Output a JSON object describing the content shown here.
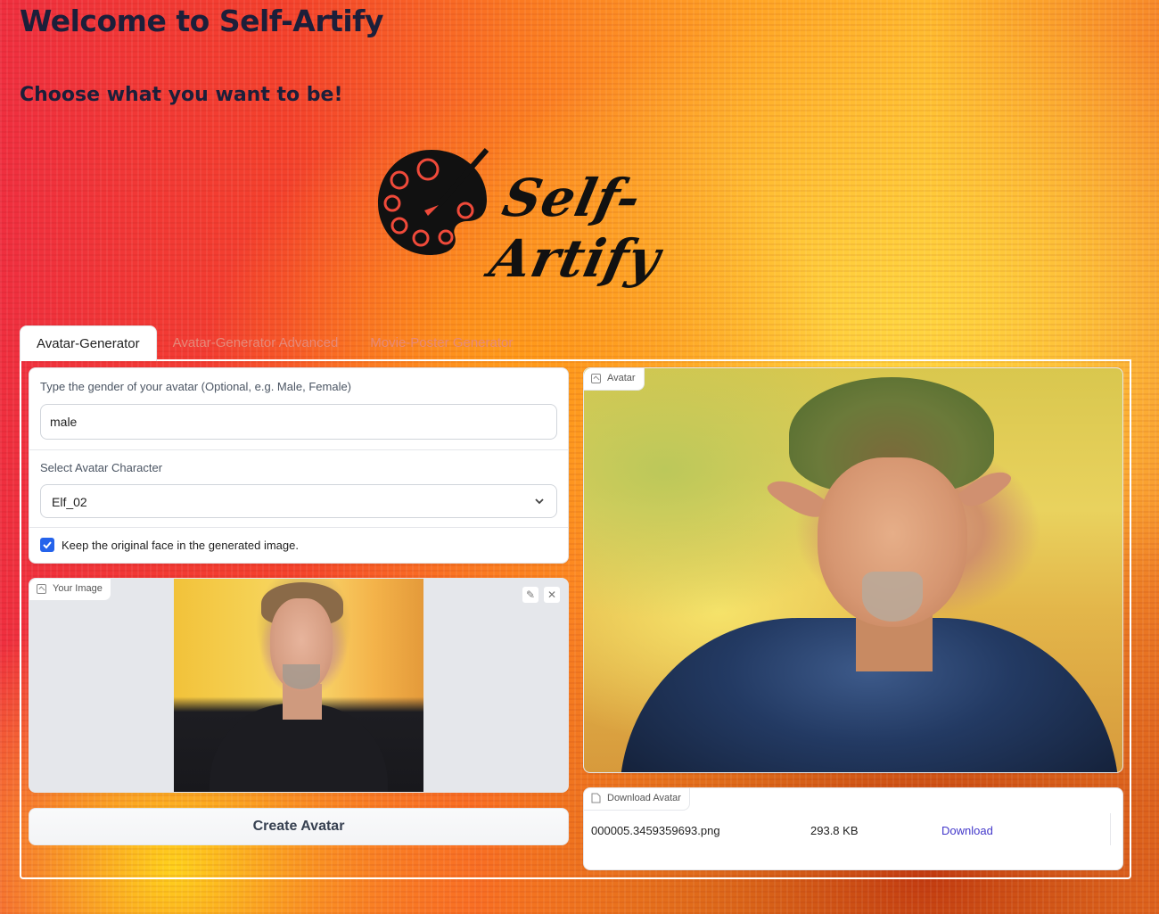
{
  "header": {
    "title": "Welcome to Self-Artify",
    "subtitle": "Choose what you want to be!",
    "logo_text": "Self-Artify"
  },
  "tabs": [
    {
      "label": "Avatar-Generator",
      "active": true
    },
    {
      "label": "Avatar-Generator Advanced",
      "active": false
    },
    {
      "label": "Movie-Poster Generator",
      "active": false
    }
  ],
  "form": {
    "gender_label": "Type the gender of your avatar (Optional, e.g. Male, Female)",
    "gender_value": "male",
    "character_label": "Select Avatar Character",
    "character_value": "Elf_02",
    "keep_face_label": "Keep the original face in the generated image.",
    "keep_face_checked": true
  },
  "input_image": {
    "label": "Your Image",
    "edit_icon": "pencil-icon",
    "clear_icon": "close-icon"
  },
  "create_button": "Create Avatar",
  "avatar_output": {
    "label": "Avatar"
  },
  "download": {
    "label": "Download Avatar",
    "file_name": "000005.3459359693.png",
    "file_size": "293.8 KB",
    "link_text": "Download"
  },
  "colors": {
    "accent_checkbox": "#2563eb",
    "download_link": "#4338ca",
    "title_text": "#1c1f3a"
  }
}
